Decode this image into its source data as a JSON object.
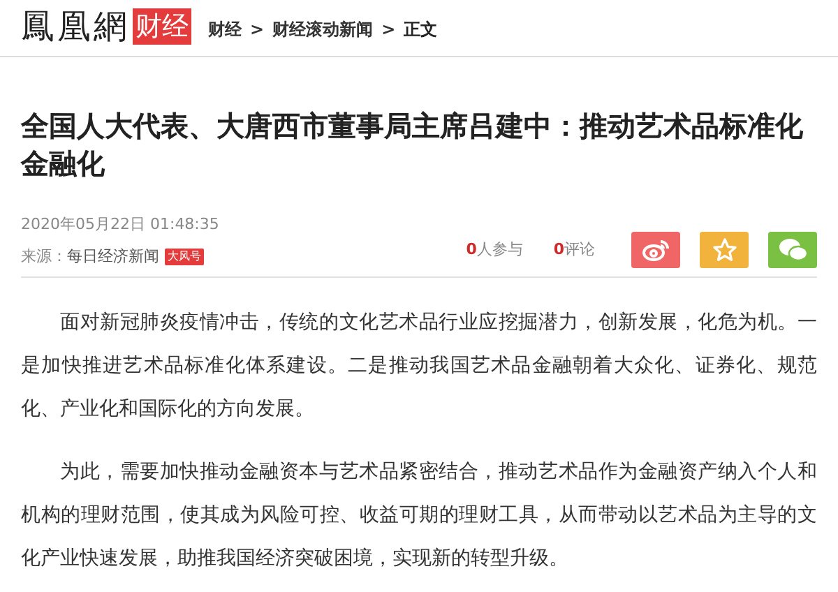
{
  "logo": {
    "text": "鳳凰網",
    "channel": "财经"
  },
  "breadcrumb": [
    {
      "label": "财经",
      "kind": "link"
    },
    {
      "label": "财经滚动新闻",
      "kind": "link"
    },
    {
      "label": "正文",
      "kind": "current"
    }
  ],
  "breadcrumb_separator": ">",
  "article": {
    "title": "全国人大代表、大唐西市董事局主席吕建中：推动艺术品标准化金融化",
    "date": "2020年05月22日 01:48:35",
    "source_label": "来源：",
    "source": "每日经济新闻",
    "badge": "大风号",
    "participants": {
      "count": "0",
      "label": "人参与"
    },
    "comments": {
      "count": "0",
      "label": "评论"
    },
    "share_buttons": [
      {
        "kind": "weibo",
        "color": "#f06565"
      },
      {
        "kind": "favorite",
        "color": "#f2b33d"
      },
      {
        "kind": "wechat",
        "color": "#7ac143"
      }
    ],
    "paragraphs": [
      "面对新冠肺炎疫情冲击，传统的文化艺术品行业应挖掘潜力，创新发展，化危为机。一是加快推进艺术品标准化体系建设。二是推动我国艺术品金融朝着大众化、证券化、规范化、产业化和国际化的方向发展。",
      "为此，需要加快推动金融资本与艺术品紧密结合，推动艺术品作为金融资产纳入个人和机构的理财范围，使其成为风险可控、收益可期的理财工具，从而带动以艺术品为主导的文化产业快速发展，助推我国经济突破困境，实现新的转型升级。"
    ]
  }
}
